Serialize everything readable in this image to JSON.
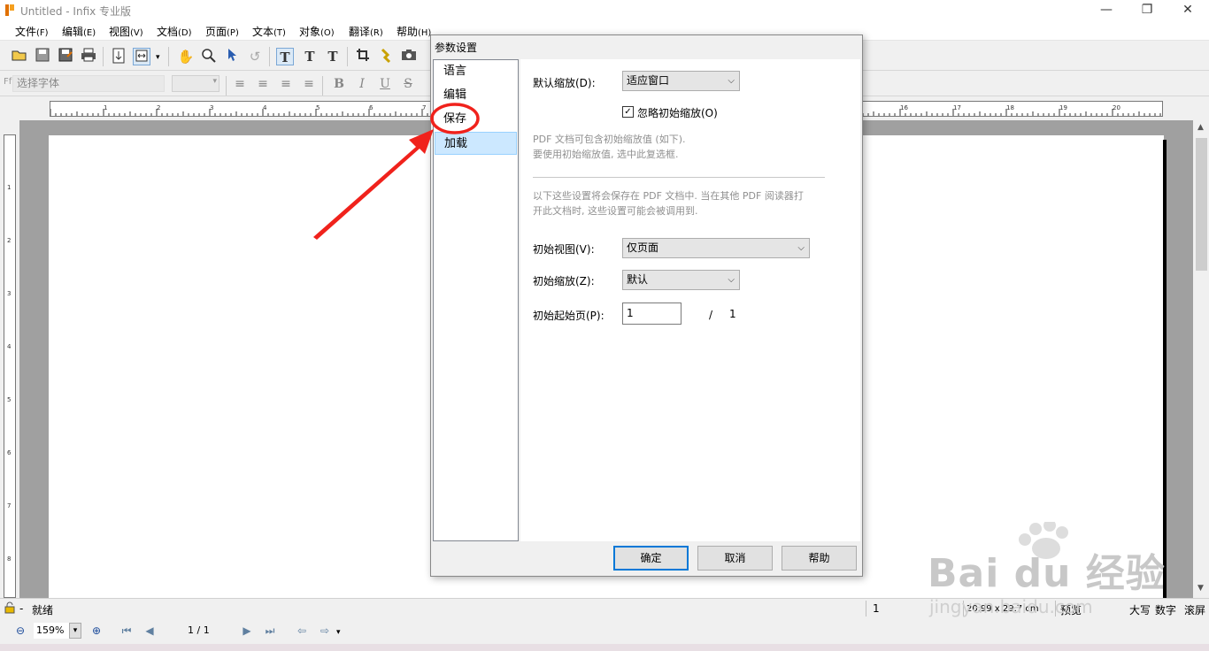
{
  "window": {
    "title": "Untitled - Infix 专业版",
    "minimize_glyph": "—",
    "maximize_glyph": "❐",
    "close_glyph": "✕"
  },
  "menu": [
    {
      "label": "文件",
      "key": "(F)"
    },
    {
      "label": "编辑",
      "key": "(E)"
    },
    {
      "label": "视图",
      "key": "(V)"
    },
    {
      "label": "文档",
      "key": "(D)"
    },
    {
      "label": "页面",
      "key": "(P)"
    },
    {
      "label": "文本",
      "key": "(T)"
    },
    {
      "label": "对象",
      "key": "(O)"
    },
    {
      "label": "翻译",
      "key": "(R)"
    },
    {
      "label": "帮助",
      "key": "(H)"
    }
  ],
  "toolbar": {
    "icons": [
      "open-folder-icon",
      "save-icon",
      "save-as-icon",
      "print-icon",
      "export-icon",
      "fit-page-icon",
      "hand-tool-icon",
      "zoom-icon",
      "select-arrow-icon",
      "rotate-icon",
      "text-tool-icon",
      "text-flow-icon",
      "superscript-icon",
      "crop-icon",
      "link-icon",
      "camera-icon"
    ]
  },
  "format_toolbar": {
    "font_placeholder": "选择字体",
    "font_glyph": "Ff",
    "bold": "B",
    "italic": "I",
    "underline": "U",
    "strike": "S"
  },
  "ruler": {
    "h_numbers": [
      "1",
      "2",
      "3",
      "4",
      "5",
      "6",
      "7",
      "16",
      "17",
      "18",
      "19",
      "20"
    ],
    "v_numbers": [
      "1",
      "2",
      "3",
      "4",
      "5",
      "6",
      "7",
      "8"
    ]
  },
  "dialog": {
    "title": "参数设置",
    "categories": [
      {
        "label": "语言",
        "selected": false
      },
      {
        "label": "编辑",
        "selected": false
      },
      {
        "label": "保存",
        "selected": false
      },
      {
        "label": "加载",
        "selected": true
      }
    ],
    "default_zoom_label": "默认缩放(D):",
    "default_zoom_value": "适应窗口",
    "ignore_initial_zoom_label": "忽略初始缩放(O)",
    "ignore_initial_zoom_checked": true,
    "hint1_line1": "PDF 文档可包含初始缩放值 (如下).",
    "hint1_line2": "要使用初始缩放值, 选中此复选框.",
    "hint2_line1": "以下这些设置将会保存在 PDF 文档中. 当在其他 PDF 阅读器打",
    "hint2_line2": "开此文档时, 这些设置可能会被调用到.",
    "initial_view_label": "初始视图(V):",
    "initial_view_value": "仅页面",
    "initial_zoom_label": "初始缩放(Z):",
    "initial_zoom_value": "默认",
    "initial_page_label": "初始起始页(P):",
    "initial_page_value": "1",
    "page_total_sep": "/",
    "page_total": "1",
    "ok_label": "确定",
    "cancel_label": "取消",
    "help_label": "帮助"
  },
  "status": {
    "ready": "就绪",
    "lock_sep": "-",
    "page_num": "1",
    "size": "20.99 x 29.7 cm",
    "mode": "预览",
    "caps": "大写",
    "num": "数字",
    "scroll": "滚屏"
  },
  "nav": {
    "zoom": "159%",
    "page": "1 / 1"
  },
  "watermark": {
    "brand": "Bai du 经验",
    "url": "jingyan.baidu.com"
  },
  "colors": {
    "annotation_red": "#f0221c",
    "selected_bg": "#cce8ff",
    "default_button_border": "#0078d7"
  }
}
